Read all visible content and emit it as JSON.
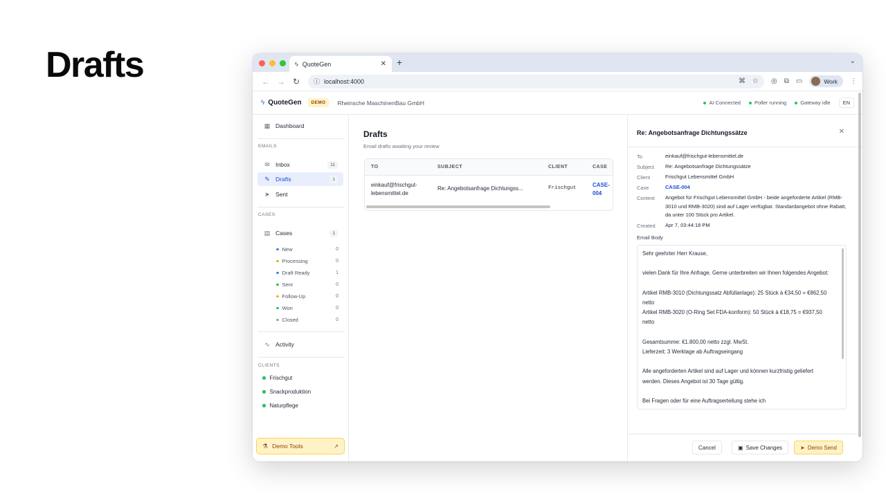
{
  "slide": {
    "title": "Drafts"
  },
  "browser": {
    "tab_title": "QuoteGen",
    "url": "localhost:4000",
    "profile_name": "Work"
  },
  "header": {
    "logo": "QuoteGen",
    "badge": "DEMO",
    "company": "Rheinsche MaschinenBau GmbH",
    "status": [
      "AI Connected",
      "Poller running",
      "Gateway idle"
    ],
    "language": "EN"
  },
  "sidebar": {
    "dashboard": "Dashboard",
    "emails_label": "EMAILS",
    "inbox": {
      "label": "Inbox",
      "count": "11"
    },
    "drafts": {
      "label": "Drafts",
      "count": "1"
    },
    "sent": {
      "label": "Sent"
    },
    "cases_label": "CASES",
    "cases": {
      "label": "Cases",
      "count": "1"
    },
    "case_statuses": [
      {
        "label": "New",
        "count": "0",
        "color": "#3b82f6"
      },
      {
        "label": "Processing",
        "count": "0",
        "color": "#eab308"
      },
      {
        "label": "Draft Ready",
        "count": "1",
        "color": "#3b82f6"
      },
      {
        "label": "Sent",
        "count": "0",
        "color": "#22c55e"
      },
      {
        "label": "Follow-Up",
        "count": "0",
        "color": "#eab308"
      },
      {
        "label": "Won",
        "count": "0",
        "color": "#22c55e"
      },
      {
        "label": "Closed",
        "count": "0",
        "color": "#9ca3af"
      }
    ],
    "activity": "Activity",
    "clients_label": "CLIENTS",
    "clients": [
      "Frischgut",
      "Snackproduktion",
      "Naturpflege"
    ],
    "demo_tools": "Demo Tools"
  },
  "main": {
    "title": "Drafts",
    "subtitle": "Email drafts awaiting your review",
    "columns": [
      "TO",
      "SUBJECT",
      "CLIENT",
      "CASE"
    ],
    "rows": [
      {
        "to_line1": "einkauf@frischgut-",
        "to_line2": "lebensmittel.de",
        "subject": "Re: Angebotsanfrage Dichtungss...",
        "client": "Frischgut",
        "case_line1": "CASE-",
        "case_line2": "004"
      }
    ]
  },
  "detail": {
    "title": "Re: Angebotsanfrage Dichtungssätze",
    "labels": {
      "to": "To",
      "subject": "Subject",
      "client": "Client",
      "case": "Case",
      "context": "Context",
      "created": "Created",
      "body": "Email Body"
    },
    "to": "einkauf@frischgut-lebensmittel.de",
    "subject": "Re: Angebotsanfrage Dichtungssätze",
    "client": "Frischgut Lebensmittel GmbH",
    "case": "CASE-004",
    "context": "Angebot für Frischgut Lebensmittel GmbH - beide angeforderte Artikel (RMB-3010 und RMB-3020) sind auf Lager verfügbar. Standardangebot ohne Rabatt, da unter 100 Stück pro Artikel.",
    "created": "Apr 7, 03:44:18 PM",
    "body_lines": [
      "Sehr geehrter Herr Krause,",
      "",
      "vielen Dank für Ihre Anfrage. Gerne unterbreiten wir Ihnen folgendes Angebot:",
      "",
      "Artikel RMB-3010 (Dichtungssatz Abfüllanlage): 25 Stück à €34,50 = €862,50 netto",
      "Artikel RMB-3020 (O-Ring Set FDA-konform): 50 Stück à €18,75 = €937,50 netto",
      "",
      "Gesamtsumme: €1.800,00 netto zzgl. MwSt.",
      "Lieferzeit: 3 Werktage ab Auftragseingang",
      "",
      "Alle angeforderten Artikel sind auf Lager und können kurzfristig geliefert werden. Dieses Angebot ist 30 Tage gültig.",
      "",
      "Bei Fragen oder für eine Auftragserteilung stehe ich"
    ],
    "buttons": {
      "cancel": "Cancel",
      "save": "Save Changes",
      "send": "Demo Send"
    }
  }
}
